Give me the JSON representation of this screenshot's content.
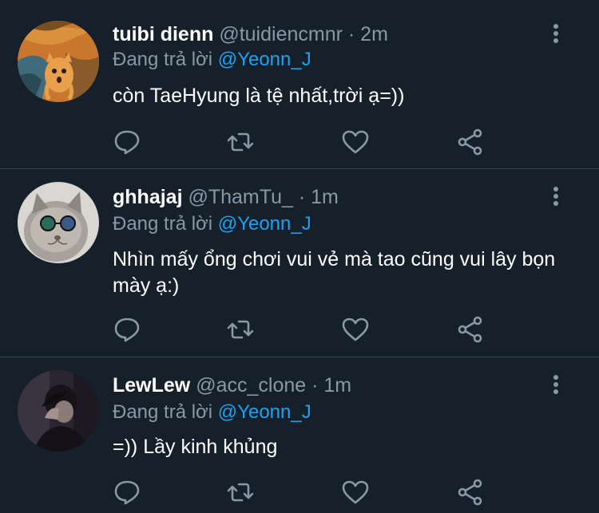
{
  "tweets": [
    {
      "name": "tuibi dienn",
      "handle": "@tuidiencmnr",
      "separator": "·",
      "time": "2m",
      "reply_prefix": "Đang trả lời",
      "reply_to": "@Yeonn_J",
      "text": "còn TaeHyung là tệ nhất,trời ạ=))"
    },
    {
      "name": "ghhajaj",
      "handle": "@ThamTu_",
      "separator": "·",
      "time": "1m",
      "reply_prefix": "Đang trả lời",
      "reply_to": "@Yeonn_J",
      "text": "Nhìn mấy ổng chơi vui vẻ mà tao cũng vui lây bọn mày ạ:)"
    },
    {
      "name": "LewLew",
      "handle": "@acc_clone",
      "separator": "·",
      "time": "1m",
      "reply_prefix": "Đang trả lời",
      "reply_to": "@Yeonn_J",
      "text": "=)) Lầy kinh khủng"
    }
  ],
  "icons": {
    "reply": "comment-icon",
    "retweet": "retweet-icon",
    "like": "heart-icon",
    "share": "share-icon",
    "more": "more-vertical-icon"
  },
  "colors": {
    "background": "#15202b",
    "muted": "#8899a6",
    "mention": "#1da1f2",
    "divider": "#38444d"
  }
}
